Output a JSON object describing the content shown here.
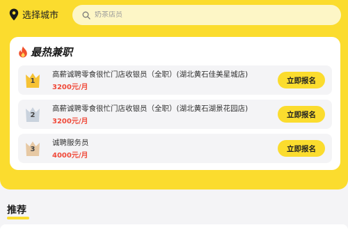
{
  "header": {
    "city_label": "选择城市",
    "search_placeholder": "奶茶店员"
  },
  "hot_section": {
    "title": "最热兼职",
    "jobs": [
      {
        "rank": "1",
        "title": "高薪诚聘零食很忙门店收银员（全职）(湖北黄石佳美星城店)",
        "salary": "3200元/月",
        "button": "立即报名",
        "badge_color": "#f6c234"
      },
      {
        "rank": "2",
        "title": "高薪诚聘零食很忙门店收银员（全职）(湖北黄石湖景花园店)",
        "salary": "3200元/月",
        "button": "立即报名",
        "badge_color": "#c9d2dd"
      },
      {
        "rank": "3",
        "title": "诚聘服务员",
        "salary": "4000元/月",
        "button": "立即报名",
        "badge_color": "#e7c9a4"
      }
    ]
  },
  "recommend": {
    "title": "推荐"
  },
  "colors": {
    "accent": "#fbdc2e",
    "salary": "#f04a3a",
    "fire": "#f0502c"
  },
  "icons": [
    "location-pin-icon",
    "search-icon",
    "fire-icon",
    "crown-icon"
  ]
}
